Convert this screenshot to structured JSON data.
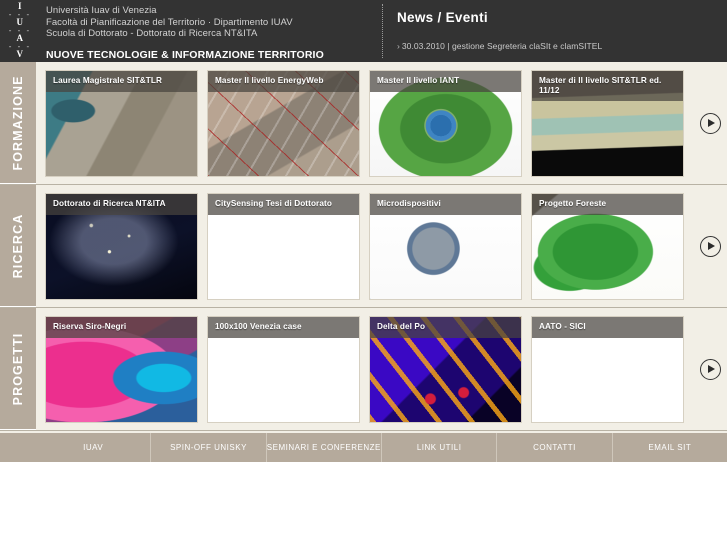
{
  "header": {
    "logo": {
      "letters": [
        "I",
        "U",
        "A",
        "V"
      ],
      "dashes": "- - -"
    },
    "institution_lines": [
      "Università Iuav di Venezia",
      "Facoltà di Pianificazione del Territorio · Dipartimento IUAV",
      "Scuola di Dottorato - Dottorato di Ricerca NT&ITA"
    ],
    "main_title": "NUOVE TECNOLOGIE & INFORMAZIONE TERRITORIO AMBIENTE",
    "news": {
      "title": "News / Eventi",
      "items": [
        {
          "bullet": "›",
          "text": "30.03.2010 | gestione Segreteria claSIt e clamSITEL"
        }
      ]
    }
  },
  "sections": [
    {
      "label": "FORMAZIONE",
      "next_button_label": "next-arrow",
      "cards": [
        {
          "title": "Laurea Magistrale SIT&TLR",
          "image": "img-venice-port"
        },
        {
          "title": "Master II livello EnergyWeb",
          "image": "img-aerial-red"
        },
        {
          "title": "Master II livello IANT",
          "image": "img-leaf-globe"
        },
        {
          "title": "Master di II livello SIT&TLR ed. 11/12",
          "image": "img-dem"
        }
      ]
    },
    {
      "label": "RICERCA",
      "next_button_label": "next-arrow",
      "cards": [
        {
          "title": "Dottorato di Ricerca NT&ITA",
          "image": "img-night-europe"
        },
        {
          "title": "CitySensing Tesi di Dottorato",
          "image": "img-layers"
        },
        {
          "title": "Microdispositivi",
          "image": "img-micro"
        },
        {
          "title": "Progetto Foreste",
          "image": "img-forest"
        }
      ]
    },
    {
      "label": "PROGETTI",
      "next_button_label": "next-arrow",
      "cards": [
        {
          "title": "Riserva Siro-Negri",
          "image": "img-infrared"
        },
        {
          "title": "100x100 Venezia case",
          "image": "img-chair"
        },
        {
          "title": "Delta del Po",
          "image": "img-lidar"
        },
        {
          "title": "AATO - SICI",
          "image": "img-beach"
        }
      ]
    }
  ],
  "footer": {
    "items": [
      {
        "label": "IUAV"
      },
      {
        "label": "SPIN-OFF UNISKY"
      },
      {
        "label": "SEMINARI E CONFERENZE"
      },
      {
        "label": "LINK UTILI"
      },
      {
        "label": "CONTATTI"
      },
      {
        "label": "EMAIL SIT"
      }
    ]
  },
  "colors": {
    "header_bg": "#333333",
    "content_bg": "#f2efe6",
    "sidebar_label_bg": "#b5aa9c",
    "footer_bg": "#b5aa9c",
    "card_border": "#d6d0c2",
    "card_title_overlay": "rgba(72,68,63,0.72)"
  }
}
